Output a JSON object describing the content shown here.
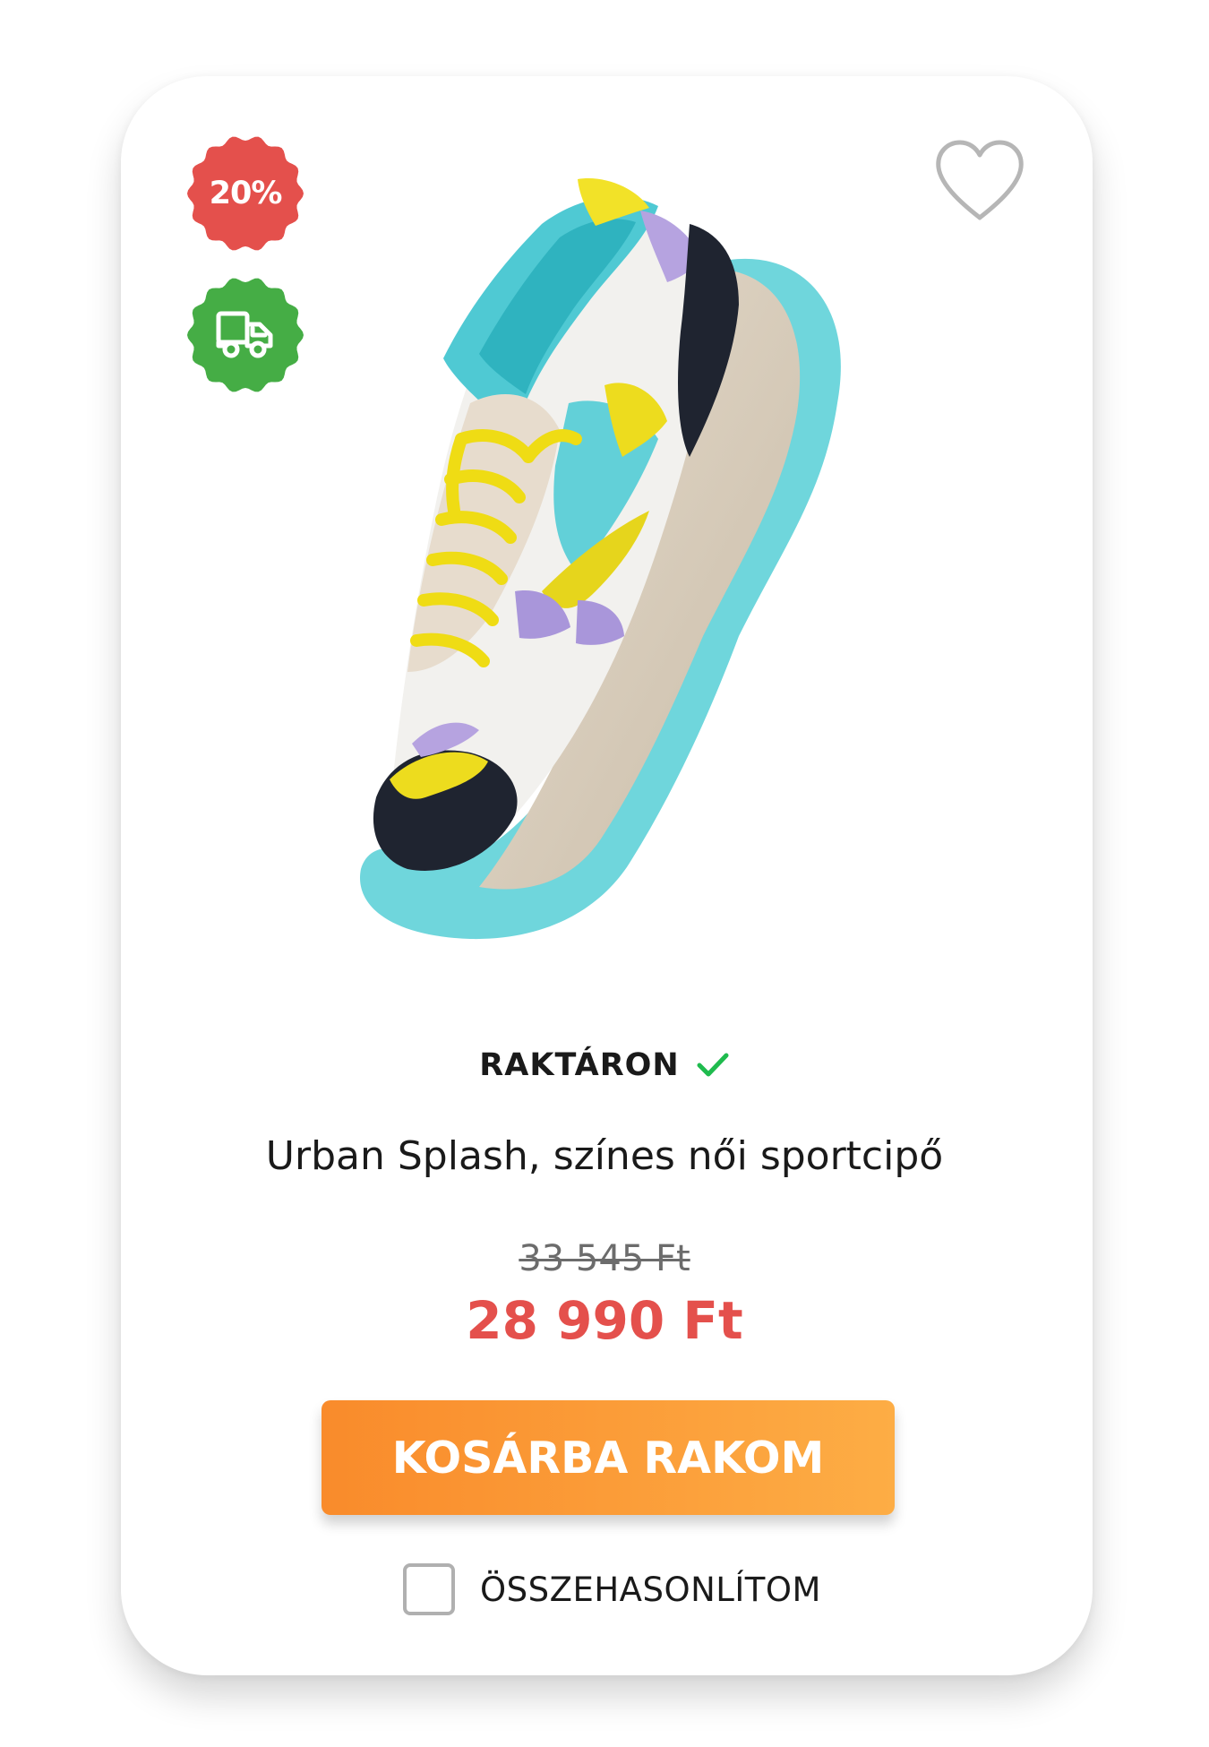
{
  "badges": {
    "discount": {
      "label": "20%",
      "color": "#e4504c"
    },
    "shipping": {
      "icon": "delivery-truck-icon",
      "color": "#45ad45"
    }
  },
  "wishlist": {
    "icon": "heart-icon"
  },
  "product": {
    "image": "sneaker-product-image",
    "stock_label": "RAKTÁRON",
    "stock_icon": "checkmark-icon",
    "title": "Urban Splash, színes női sportcipő",
    "old_price": "33 545 Ft",
    "new_price": "28 990 Ft"
  },
  "actions": {
    "cart_label": "KOSÁRBA RAKOM",
    "compare_label": "ÖSSZEHASONLÍTOM",
    "compare_checked": false
  },
  "colors": {
    "price_red": "#e4504c",
    "button_orange": "#f98b2b",
    "stock_green": "#1fbb4e"
  }
}
